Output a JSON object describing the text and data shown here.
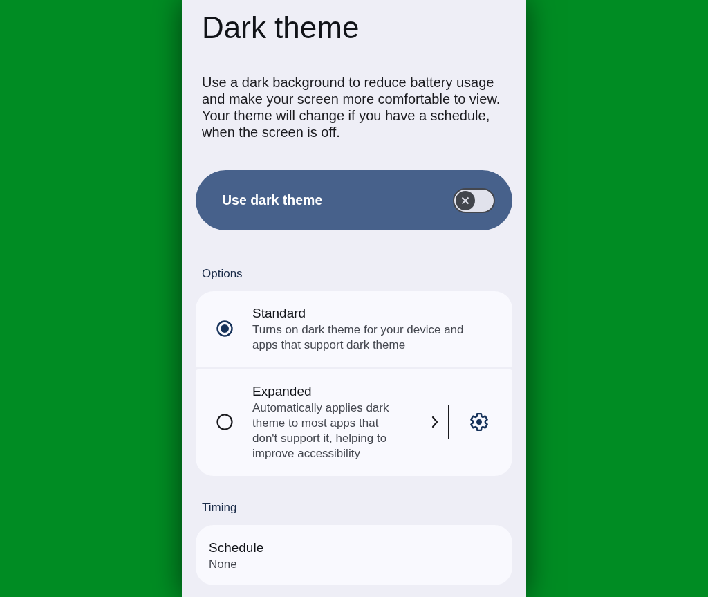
{
  "title": "Dark theme",
  "description": "Use a dark background to reduce battery usage and make your screen more comfortable to view. Your theme will change if you have a schedule, when the screen is off.",
  "main_switch": {
    "label": "Use dark theme",
    "on": false
  },
  "sections": [
    {
      "heading": "Options",
      "items": [
        {
          "kind": "radio",
          "title": "Standard",
          "subtitle": "Turns on dark theme for your device and apps that support dark theme",
          "selected": true
        },
        {
          "kind": "radio_settings",
          "title": "Expanded",
          "subtitle": "Automatically applies dark theme to most apps that don't support it, helping to improve accessibility",
          "selected": false
        }
      ]
    },
    {
      "heading": "Timing",
      "items": [
        {
          "kind": "summary",
          "title": "Schedule",
          "subtitle": "None"
        }
      ]
    }
  ]
}
